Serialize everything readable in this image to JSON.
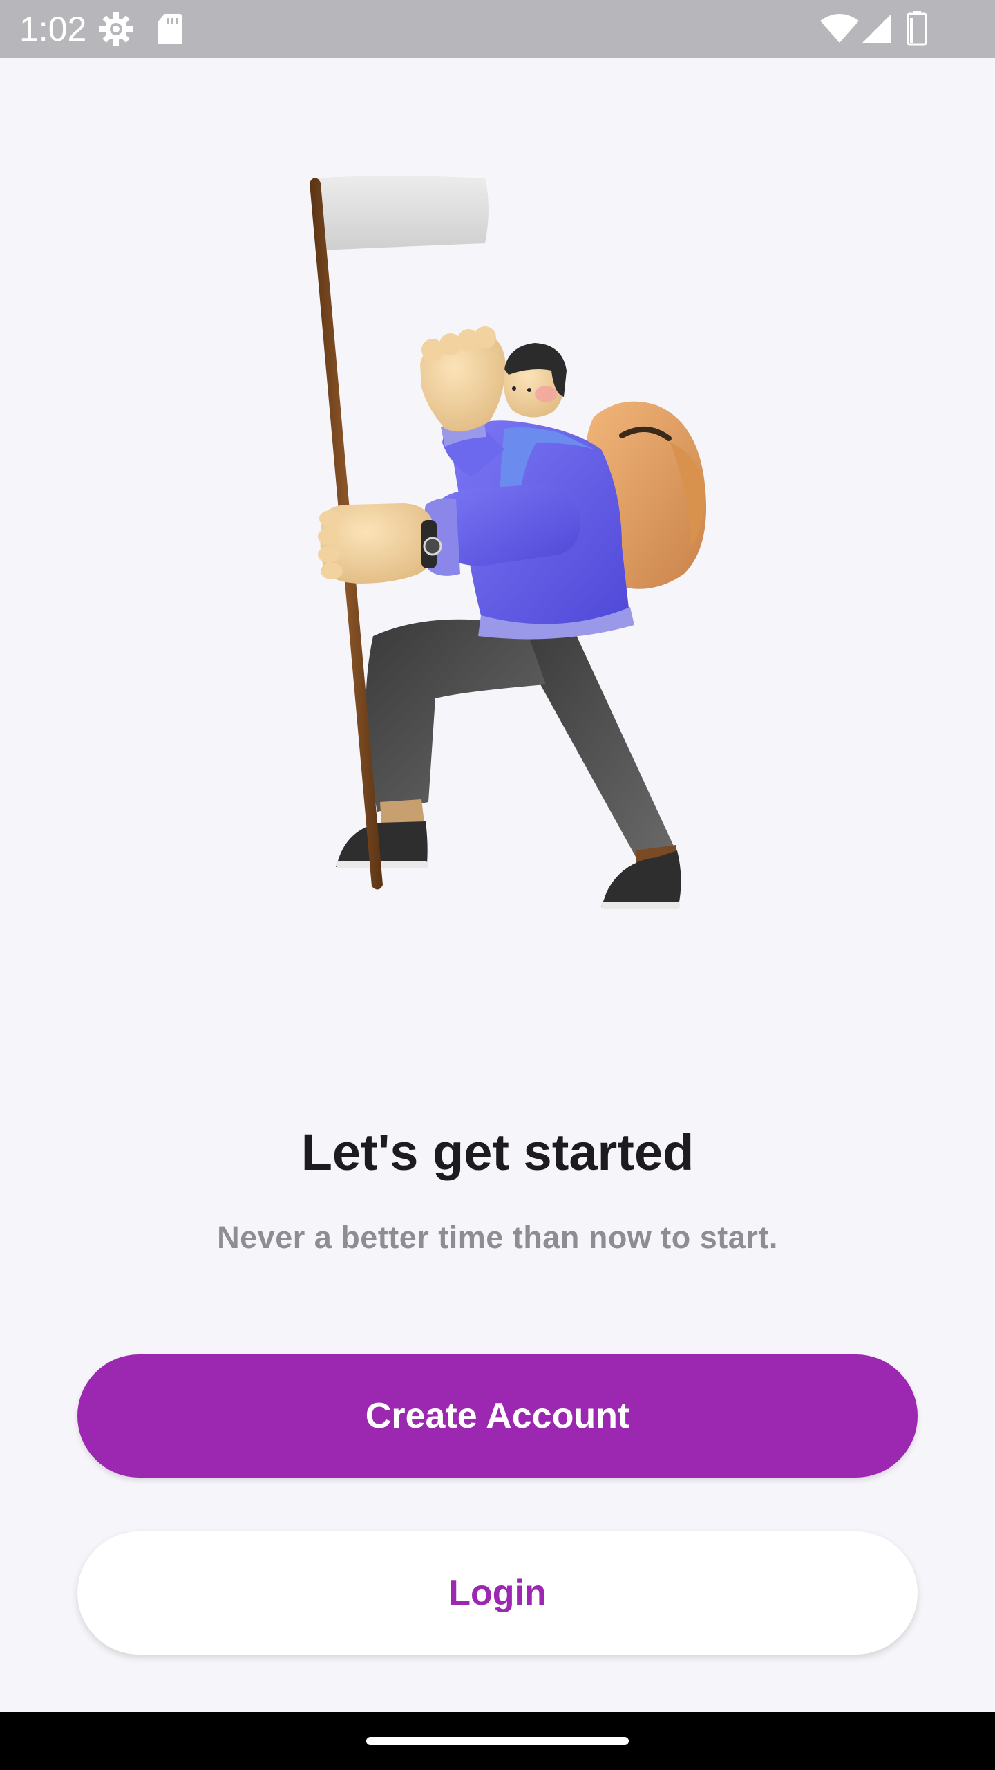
{
  "status_bar": {
    "time": "1:02",
    "icons": [
      "settings-gear-icon",
      "sd-card-icon",
      "wifi-icon",
      "cellular-signal-icon",
      "battery-icon"
    ],
    "background": "#b7b7bb"
  },
  "illustration": {
    "subject": "hiker-with-flag-icon"
  },
  "main": {
    "title": "Let's get started",
    "subtitle": "Never a better time than now to start."
  },
  "actions": {
    "create_account_label": "Create Account",
    "login_label": "Login"
  },
  "colors": {
    "accent": "#9c27b0",
    "background": "#f6f5f9",
    "title": "#1d1b20",
    "subtitle": "#8f8d94",
    "nav_bar": "#000000"
  }
}
